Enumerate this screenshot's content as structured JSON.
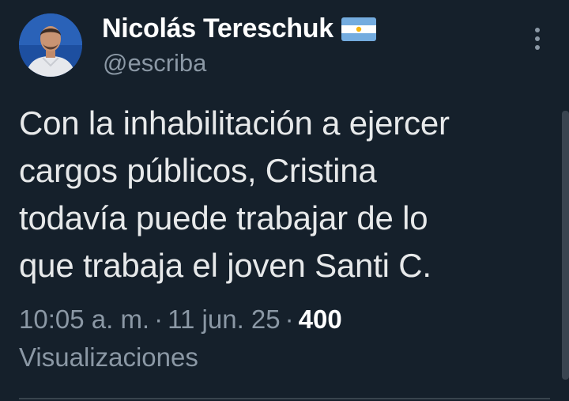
{
  "author": {
    "display_name": "Nicolás Tereschuk",
    "handle": "@escriba",
    "badge_icon": "argentina-flag-icon",
    "avatar_icon": "avatar-photo"
  },
  "tweet": {
    "text": "Con la inhabilitación a ejercer\ncargos públicos, Cristina\ntodavía puede trabajar de lo\nque trabaja el joven Santi C.",
    "time": "10:05 a. m.",
    "separator": "·",
    "date": "11 jun. 25",
    "views_count": "400",
    "views_label": "Visualizaciones"
  },
  "menu": {
    "icon": "more-vertical-icon"
  },
  "colors": {
    "background": "#15202b",
    "primary_text": "#e7e9ea",
    "secondary_text": "#8b98a5",
    "flag_blue": "#74acdf",
    "flag_sun": "#f6b40e"
  }
}
